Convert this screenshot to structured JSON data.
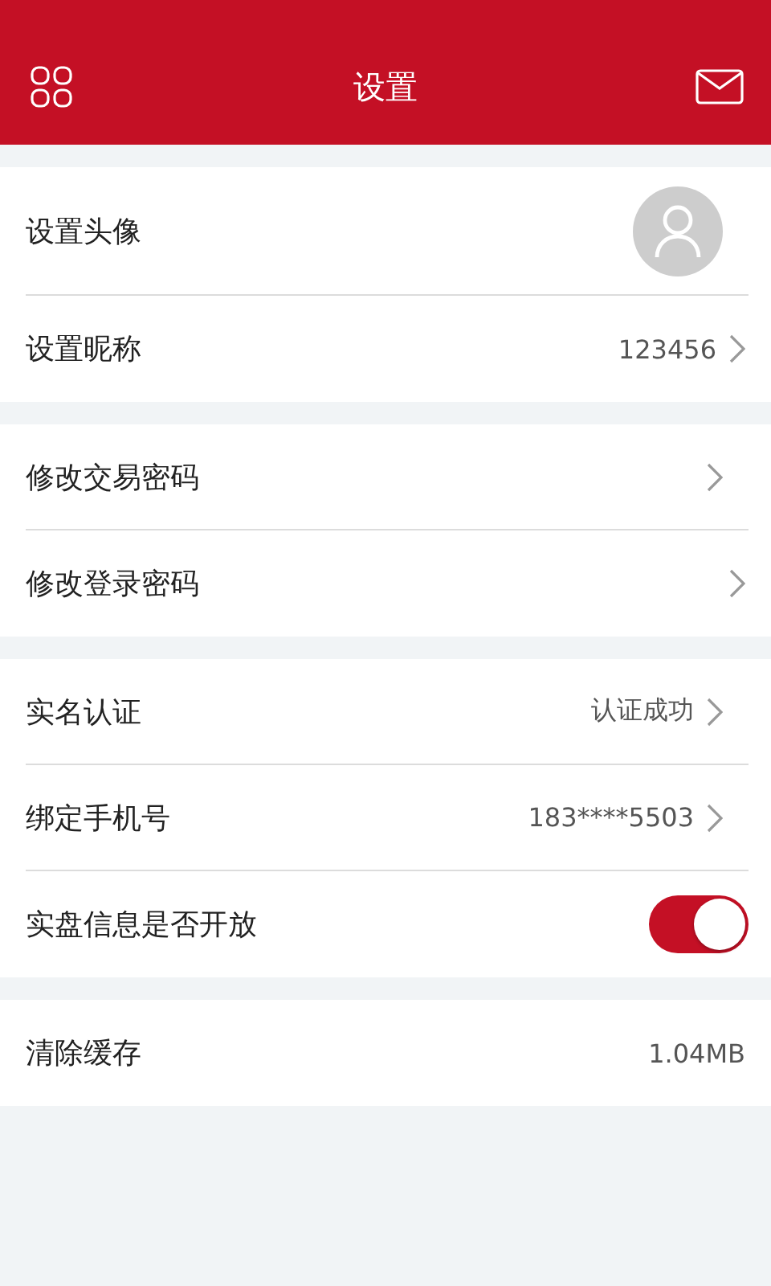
{
  "header": {
    "title": "设置"
  },
  "groups": [
    {
      "rows": [
        {
          "kind": "avatar",
          "label": "设置头像"
        },
        {
          "kind": "link",
          "label": "设置昵称",
          "value": "123456"
        }
      ]
    },
    {
      "rows": [
        {
          "kind": "link",
          "label": "修改交易密码"
        },
        {
          "kind": "link",
          "label": "修改登录密码"
        }
      ]
    },
    {
      "rows": [
        {
          "kind": "link",
          "label": "实名认证",
          "value": "认证成功"
        },
        {
          "kind": "link",
          "label": "绑定手机号",
          "value": "183****5503"
        },
        {
          "kind": "toggle",
          "label": "实盘信息是否开放",
          "on": true
        }
      ]
    },
    {
      "rows": [
        {
          "kind": "info",
          "label": "清除缓存",
          "value": "1.04MB"
        }
      ]
    }
  ]
}
